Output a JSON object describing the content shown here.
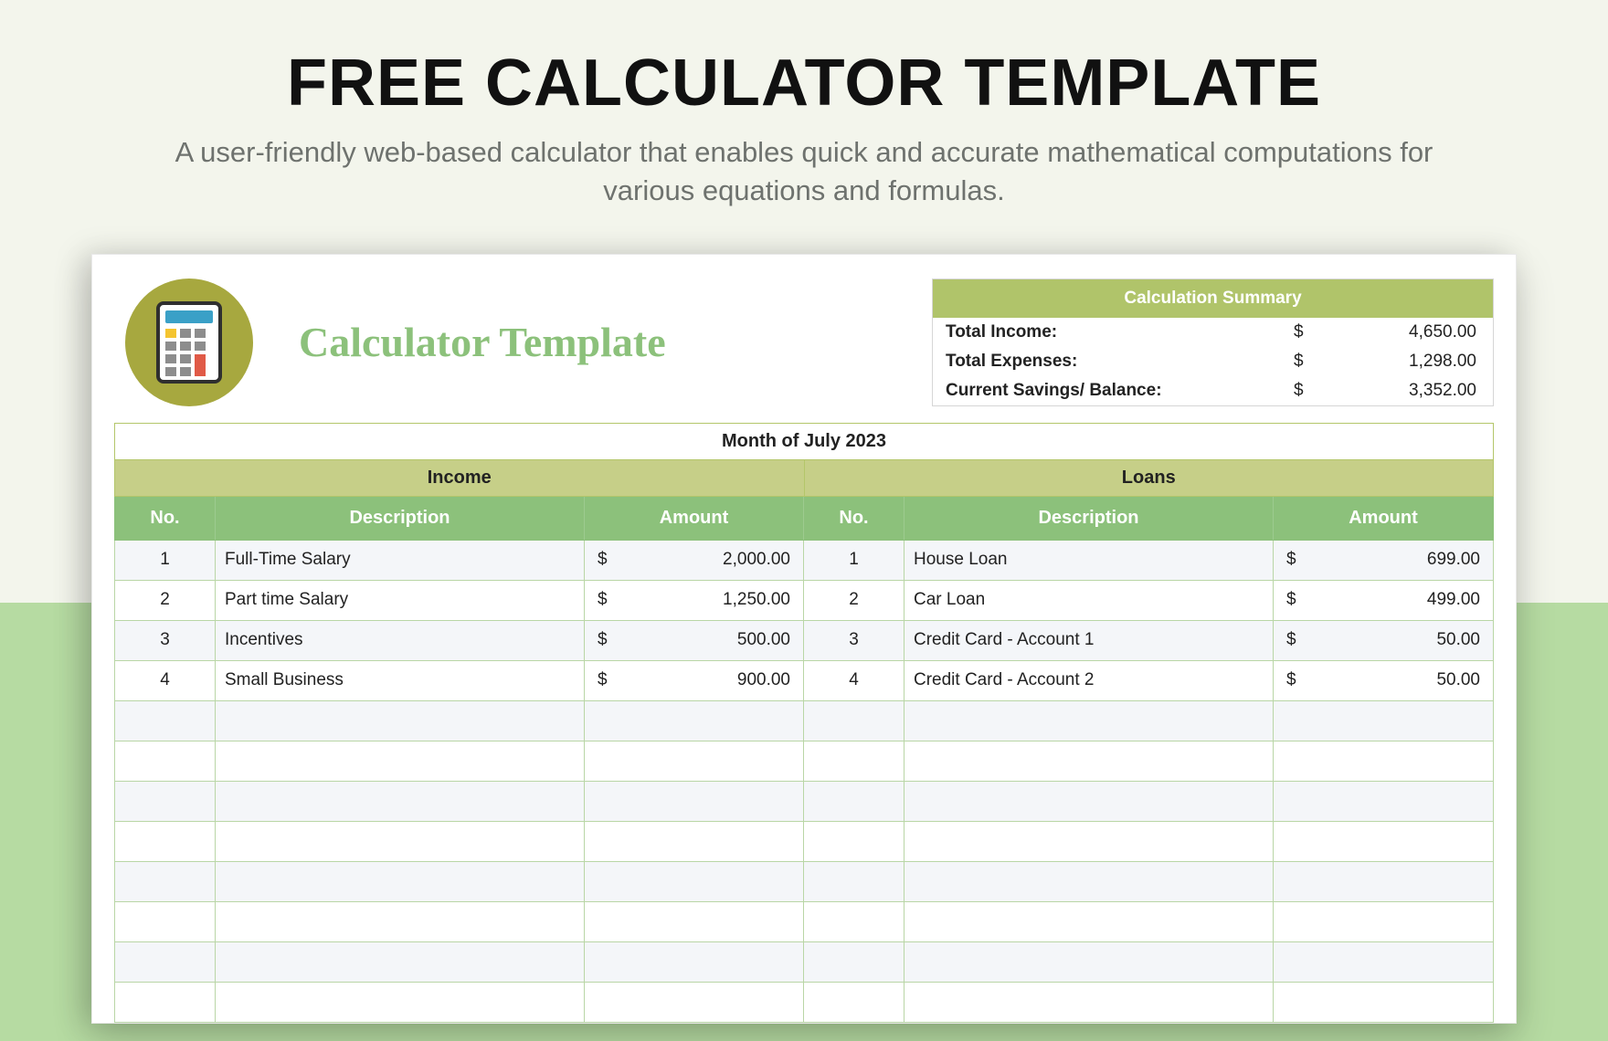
{
  "hero": {
    "title": "FREE CALCULATOR TEMPLATE",
    "subtitle": "A user-friendly web-based calculator that enables quick and accurate mathematical computations for various equations and formulas."
  },
  "sheet": {
    "title": "Calculator Template",
    "month_label": "Month of July 2023",
    "section_income": "Income",
    "section_loans": "Loans",
    "headers": {
      "no": "No.",
      "desc": "Description",
      "amount": "Amount"
    },
    "currency": "$"
  },
  "summary": {
    "header": "Calculation Summary",
    "rows": [
      {
        "label": "Total Income:",
        "value": "4,650.00"
      },
      {
        "label": "Total Expenses:",
        "value": "1,298.00"
      },
      {
        "label": "Current Savings/ Balance:",
        "value": "3,352.00"
      }
    ]
  },
  "income": [
    {
      "no": "1",
      "desc": "Full-Time Salary",
      "amount": "2,000.00"
    },
    {
      "no": "2",
      "desc": "Part time Salary",
      "amount": "1,250.00"
    },
    {
      "no": "3",
      "desc": "Incentives",
      "amount": "500.00"
    },
    {
      "no": "4",
      "desc": "Small Business",
      "amount": "900.00"
    }
  ],
  "loans": [
    {
      "no": "1",
      "desc": "House Loan",
      "amount": "699.00"
    },
    {
      "no": "2",
      "desc": "Car Loan",
      "amount": "499.00"
    },
    {
      "no": "3",
      "desc": "Credit Card - Account 1",
      "amount": "50.00"
    },
    {
      "no": "4",
      "desc": "Credit Card - Account 2",
      "amount": "50.00"
    }
  ],
  "empty_rows": 8
}
